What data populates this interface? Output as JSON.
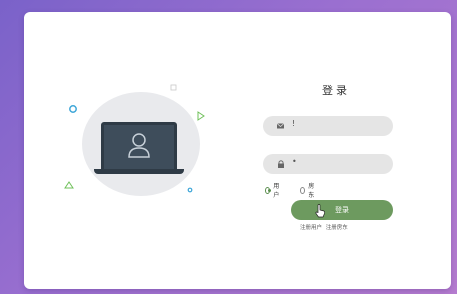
{
  "login": {
    "title": "登录",
    "username": {
      "icon": "envelope-icon",
      "value": "!"
    },
    "password": {
      "icon": "lock-icon",
      "value": "•"
    },
    "roles": [
      {
        "label": "用户",
        "checked": true
      },
      {
        "label": "房东",
        "checked": false
      }
    ],
    "submit_label": "登录",
    "links": [
      "注册用户",
      "注册房东"
    ]
  },
  "illustration": {
    "icon": "user-profile-icon",
    "device": "laptop-icon"
  },
  "colors": {
    "accent_green": "#6d9a5f",
    "background_gradient_start": "#7a62c9",
    "background_gradient_end": "#b57ccf",
    "field_bg": "#e5e5e5"
  }
}
